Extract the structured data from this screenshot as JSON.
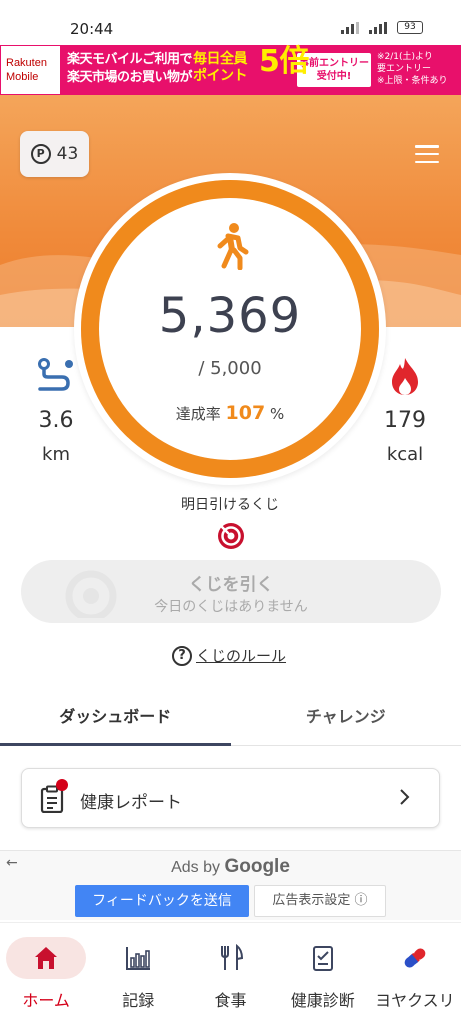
{
  "status_bar": {
    "time": "20:44",
    "battery": "93"
  },
  "banner": {
    "brand_line1": "Rakuten",
    "brand_line2": "Mobile",
    "text_line1": "楽天モバイルご利用で",
    "text_line2": "楽天市場のお買い物が",
    "point_line1": "毎日全員",
    "point_line2": "ポイント",
    "point_multiplier": "5倍",
    "entry_line1": "事前エントリー",
    "entry_line2": "受付中!",
    "note_line1": "※2/1(土)より",
    "note_line2": "要エントリー",
    "note_line3": "※上限・条件あり"
  },
  "header": {
    "points_icon": "P",
    "points": "43",
    "menu_icon": "hamburger-icon"
  },
  "steps": {
    "count": "5,369",
    "goal": "/ 5,000",
    "achievement_label": "達成率",
    "achievement_value": "107",
    "achievement_unit": "%",
    "progress": 1.0
  },
  "distance": {
    "value": "3.6",
    "unit": "km",
    "icon": "route-icon"
  },
  "calories": {
    "value": "179",
    "unit": "kcal",
    "icon": "flame-icon"
  },
  "lottery": {
    "caption": "明日引けるくじ",
    "button_label": "くじを引く",
    "button_sub": "今日のくじはありません",
    "rules_link": "くじのルール",
    "help_icon": "?"
  },
  "tabs": [
    {
      "label": "ダッシュボード",
      "active": true
    },
    {
      "label": "チャレンジ",
      "active": false
    }
  ],
  "health_report": {
    "label": "健康レポート"
  },
  "ads": {
    "back": "←",
    "ads_by": "Ads by ",
    "google": "Google",
    "feedback": "フィードバックを送信",
    "settings": "広告表示設定 ⓘ"
  },
  "bottom_nav": [
    {
      "label": "ホーム",
      "icon": "home-icon",
      "active": true
    },
    {
      "label": "記録",
      "icon": "chart-icon",
      "active": false
    },
    {
      "label": "食事",
      "icon": "cutlery-icon",
      "active": false
    },
    {
      "label": "健康診断",
      "icon": "checklist-icon",
      "active": false
    },
    {
      "label": "ヨヤクスリ",
      "icon": "pill-icon",
      "active": false
    }
  ],
  "colors": {
    "accent": "#f08a1c",
    "brand_red": "#d40019",
    "banner_pink": "#e8106b"
  }
}
